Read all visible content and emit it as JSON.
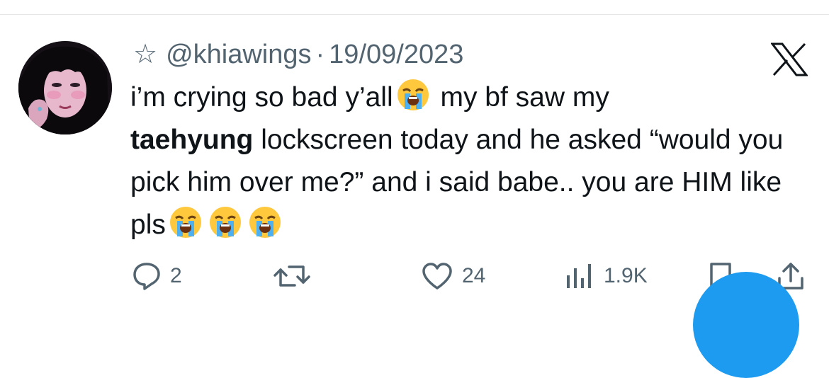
{
  "tweet": {
    "handle": "@khiawings",
    "separator": "·",
    "date": "19/09/2023",
    "text": {
      "part1": "i’m crying so bad y’all",
      "part2": " my bf saw my",
      "bold": "taehyung",
      "part3": " lockscreen today and he asked “would you pick him over me?” and i said babe.. you are HIM like pls",
      "emoji": "loudly-crying-face"
    }
  },
  "actions": {
    "replies": "2",
    "likes": "24",
    "views": "1.9K"
  },
  "icons": {
    "star": "star-outline-icon",
    "brand": "x-logo-icon",
    "reply": "reply-icon",
    "retweet": "retweet-icon",
    "like": "heart-icon",
    "views": "views-bar-chart-icon",
    "bookmark": "bookmark-icon",
    "share": "share-icon"
  },
  "colors": {
    "text": "#0f1419",
    "muted": "#536471",
    "accent": "#1d9bf0",
    "divider": "#e6e6e6"
  }
}
